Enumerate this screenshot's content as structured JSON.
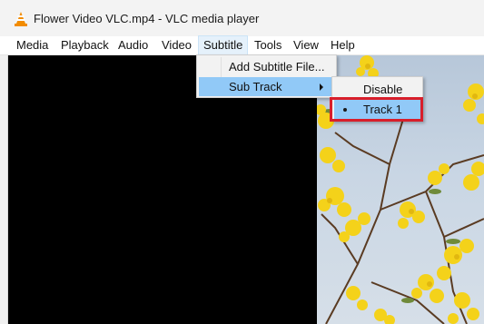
{
  "window": {
    "title": "Flower Video VLC.mp4 - VLC media player",
    "icon": "vlc-cone-icon"
  },
  "menubar": {
    "items": [
      {
        "label": "Media"
      },
      {
        "label": "Playback"
      },
      {
        "label": "Audio"
      },
      {
        "label": "Video"
      },
      {
        "label": "Subtitle"
      },
      {
        "label": "Tools"
      },
      {
        "label": "View"
      },
      {
        "label": "Help"
      }
    ],
    "active": "Subtitle"
  },
  "subtitle_menu": {
    "items": [
      {
        "label": "Add Subtitle File..."
      },
      {
        "label": "Sub Track",
        "has_submenu": true
      }
    ]
  },
  "sub_track_menu": {
    "items": [
      {
        "label": "Disable"
      },
      {
        "label": "Track 1",
        "selected": true
      }
    ]
  },
  "colors": {
    "highlight": "#91c9f7",
    "annotation_box": "#d81e2a"
  }
}
